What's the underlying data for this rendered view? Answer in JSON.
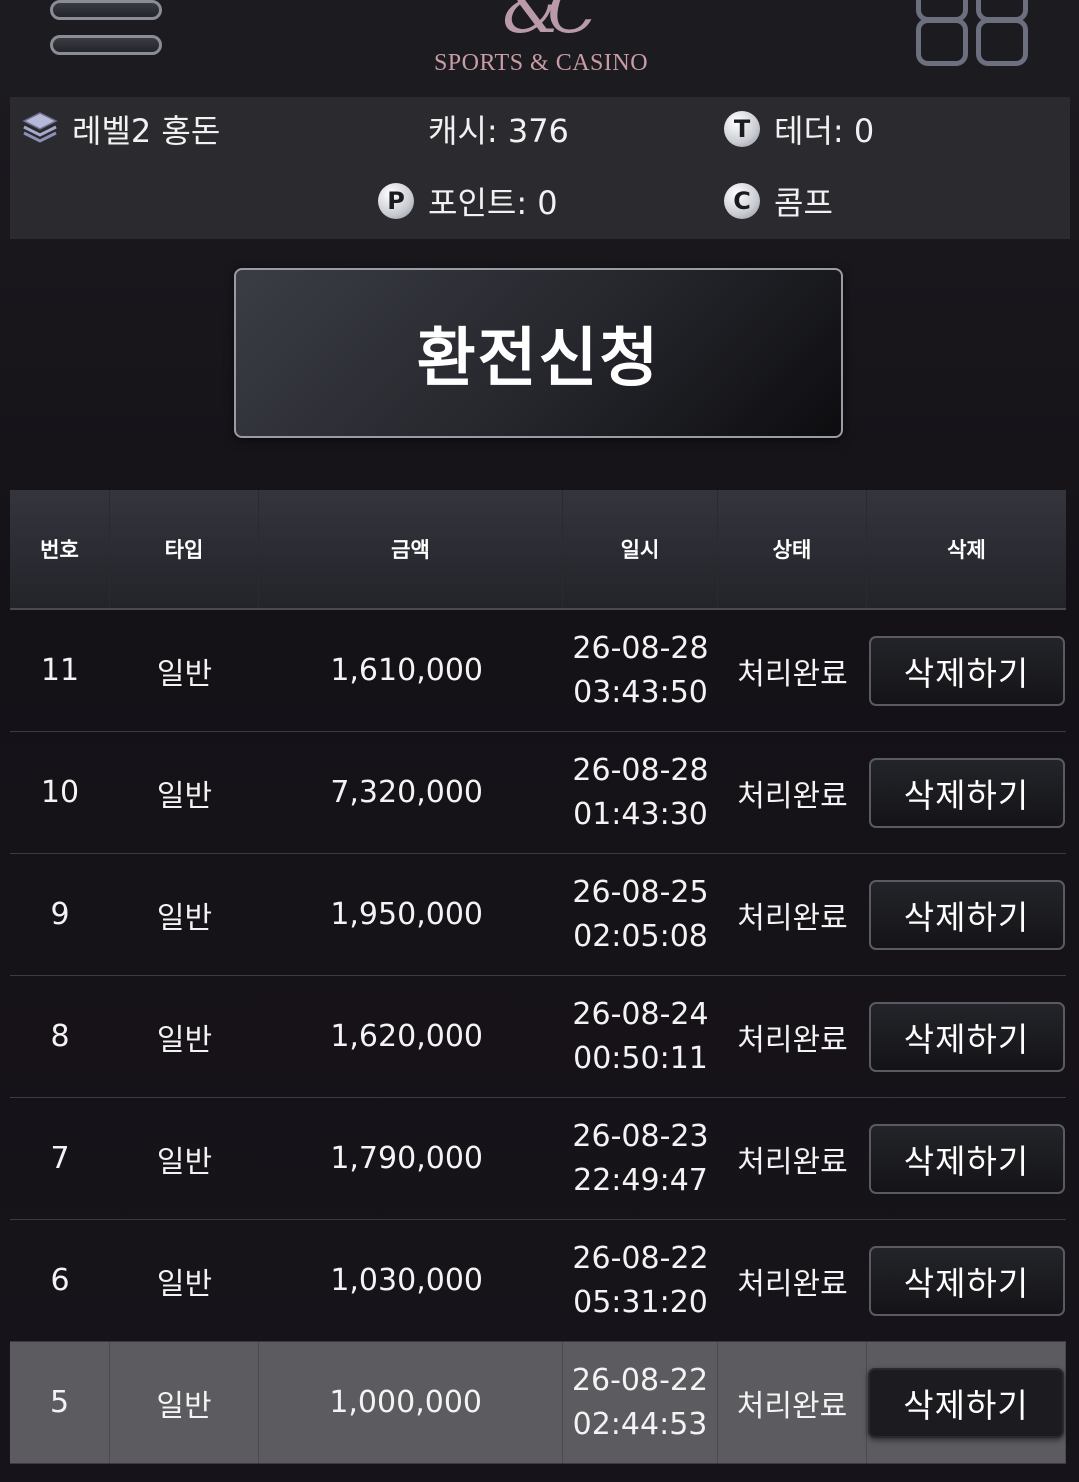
{
  "header": {
    "logo_mark": "&C",
    "logo_text": "SPORTS & CASINO"
  },
  "stats": {
    "level": "레벨2 홍돈",
    "cash": "캐시: 376",
    "tether": "테더: 0",
    "point": "포인트: 0",
    "comp": "콤프",
    "tether_icon_letter": "T",
    "point_icon_letter": "P",
    "comp_icon_letter": "C"
  },
  "withdraw_button": "환전신청",
  "table": {
    "headers": [
      "번호",
      "타입",
      "금액",
      "일시",
      "상태",
      "삭제"
    ],
    "rows": [
      {
        "no": "11",
        "type": "일반",
        "amount": "1,610,000",
        "date": "26-08-28",
        "time": "03:43:50",
        "status": "처리완료",
        "action": "삭제하기"
      },
      {
        "no": "10",
        "type": "일반",
        "amount": "7,320,000",
        "date": "26-08-28",
        "time": "01:43:30",
        "status": "처리완료",
        "action": "삭제하기"
      },
      {
        "no": "9",
        "type": "일반",
        "amount": "1,950,000",
        "date": "26-08-25",
        "time": "02:05:08",
        "status": "처리완료",
        "action": "삭제하기"
      },
      {
        "no": "8",
        "type": "일반",
        "amount": "1,620,000",
        "date": "26-08-24",
        "time": "00:50:11",
        "status": "처리완료",
        "action": "삭제하기"
      },
      {
        "no": "7",
        "type": "일반",
        "amount": "1,790,000",
        "date": "26-08-23",
        "time": "22:49:47",
        "status": "처리완료",
        "action": "삭제하기"
      },
      {
        "no": "6",
        "type": "일반",
        "amount": "1,030,000",
        "date": "26-08-22",
        "time": "05:31:20",
        "status": "처리완료",
        "action": "삭제하기"
      },
      {
        "no": "5",
        "type": "일반",
        "amount": "1,000,000",
        "date": "26-08-22",
        "time": "02:44:53",
        "status": "처리완료",
        "action": "삭제하기"
      }
    ]
  },
  "colors": {
    "background": "#161419",
    "panel": "#2b2a2e",
    "highlight_row": "#5b5b60",
    "logo": "#c89ca4"
  }
}
